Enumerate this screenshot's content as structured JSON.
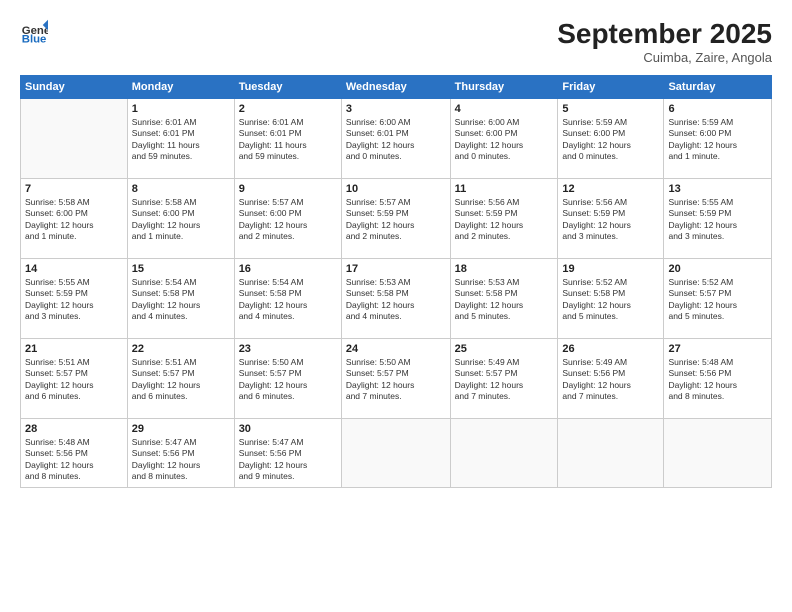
{
  "header": {
    "logo_general": "General",
    "logo_blue": "Blue",
    "month": "September 2025",
    "location": "Cuimba, Zaire, Angola"
  },
  "weekdays": [
    "Sunday",
    "Monday",
    "Tuesday",
    "Wednesday",
    "Thursday",
    "Friday",
    "Saturday"
  ],
  "weeks": [
    [
      {
        "day": "",
        "info": ""
      },
      {
        "day": "1",
        "info": "Sunrise: 6:01 AM\nSunset: 6:01 PM\nDaylight: 11 hours\nand 59 minutes."
      },
      {
        "day": "2",
        "info": "Sunrise: 6:01 AM\nSunset: 6:01 PM\nDaylight: 11 hours\nand 59 minutes."
      },
      {
        "day": "3",
        "info": "Sunrise: 6:00 AM\nSunset: 6:01 PM\nDaylight: 12 hours\nand 0 minutes."
      },
      {
        "day": "4",
        "info": "Sunrise: 6:00 AM\nSunset: 6:00 PM\nDaylight: 12 hours\nand 0 minutes."
      },
      {
        "day": "5",
        "info": "Sunrise: 5:59 AM\nSunset: 6:00 PM\nDaylight: 12 hours\nand 0 minutes."
      },
      {
        "day": "6",
        "info": "Sunrise: 5:59 AM\nSunset: 6:00 PM\nDaylight: 12 hours\nand 1 minute."
      }
    ],
    [
      {
        "day": "7",
        "info": "Sunrise: 5:58 AM\nSunset: 6:00 PM\nDaylight: 12 hours\nand 1 minute."
      },
      {
        "day": "8",
        "info": "Sunrise: 5:58 AM\nSunset: 6:00 PM\nDaylight: 12 hours\nand 1 minute."
      },
      {
        "day": "9",
        "info": "Sunrise: 5:57 AM\nSunset: 6:00 PM\nDaylight: 12 hours\nand 2 minutes."
      },
      {
        "day": "10",
        "info": "Sunrise: 5:57 AM\nSunset: 5:59 PM\nDaylight: 12 hours\nand 2 minutes."
      },
      {
        "day": "11",
        "info": "Sunrise: 5:56 AM\nSunset: 5:59 PM\nDaylight: 12 hours\nand 2 minutes."
      },
      {
        "day": "12",
        "info": "Sunrise: 5:56 AM\nSunset: 5:59 PM\nDaylight: 12 hours\nand 3 minutes."
      },
      {
        "day": "13",
        "info": "Sunrise: 5:55 AM\nSunset: 5:59 PM\nDaylight: 12 hours\nand 3 minutes."
      }
    ],
    [
      {
        "day": "14",
        "info": "Sunrise: 5:55 AM\nSunset: 5:59 PM\nDaylight: 12 hours\nand 3 minutes."
      },
      {
        "day": "15",
        "info": "Sunrise: 5:54 AM\nSunset: 5:58 PM\nDaylight: 12 hours\nand 4 minutes."
      },
      {
        "day": "16",
        "info": "Sunrise: 5:54 AM\nSunset: 5:58 PM\nDaylight: 12 hours\nand 4 minutes."
      },
      {
        "day": "17",
        "info": "Sunrise: 5:53 AM\nSunset: 5:58 PM\nDaylight: 12 hours\nand 4 minutes."
      },
      {
        "day": "18",
        "info": "Sunrise: 5:53 AM\nSunset: 5:58 PM\nDaylight: 12 hours\nand 5 minutes."
      },
      {
        "day": "19",
        "info": "Sunrise: 5:52 AM\nSunset: 5:58 PM\nDaylight: 12 hours\nand 5 minutes."
      },
      {
        "day": "20",
        "info": "Sunrise: 5:52 AM\nSunset: 5:57 PM\nDaylight: 12 hours\nand 5 minutes."
      }
    ],
    [
      {
        "day": "21",
        "info": "Sunrise: 5:51 AM\nSunset: 5:57 PM\nDaylight: 12 hours\nand 6 minutes."
      },
      {
        "day": "22",
        "info": "Sunrise: 5:51 AM\nSunset: 5:57 PM\nDaylight: 12 hours\nand 6 minutes."
      },
      {
        "day": "23",
        "info": "Sunrise: 5:50 AM\nSunset: 5:57 PM\nDaylight: 12 hours\nand 6 minutes."
      },
      {
        "day": "24",
        "info": "Sunrise: 5:50 AM\nSunset: 5:57 PM\nDaylight: 12 hours\nand 7 minutes."
      },
      {
        "day": "25",
        "info": "Sunrise: 5:49 AM\nSunset: 5:57 PM\nDaylight: 12 hours\nand 7 minutes."
      },
      {
        "day": "26",
        "info": "Sunrise: 5:49 AM\nSunset: 5:56 PM\nDaylight: 12 hours\nand 7 minutes."
      },
      {
        "day": "27",
        "info": "Sunrise: 5:48 AM\nSunset: 5:56 PM\nDaylight: 12 hours\nand 8 minutes."
      }
    ],
    [
      {
        "day": "28",
        "info": "Sunrise: 5:48 AM\nSunset: 5:56 PM\nDaylight: 12 hours\nand 8 minutes."
      },
      {
        "day": "29",
        "info": "Sunrise: 5:47 AM\nSunset: 5:56 PM\nDaylight: 12 hours\nand 8 minutes."
      },
      {
        "day": "30",
        "info": "Sunrise: 5:47 AM\nSunset: 5:56 PM\nDaylight: 12 hours\nand 9 minutes."
      },
      {
        "day": "",
        "info": ""
      },
      {
        "day": "",
        "info": ""
      },
      {
        "day": "",
        "info": ""
      },
      {
        "day": "",
        "info": ""
      }
    ]
  ]
}
